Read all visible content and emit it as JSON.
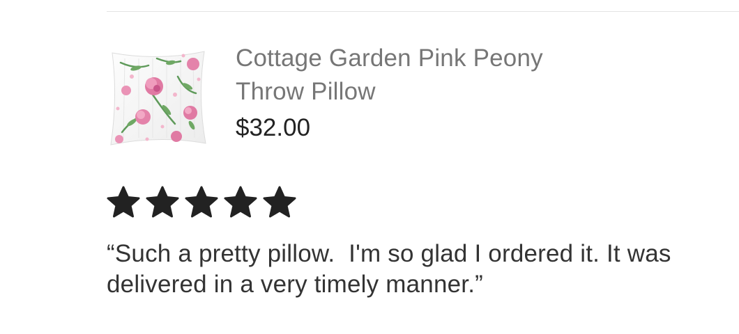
{
  "product": {
    "title_line1": "Cottage Garden Pink Peony",
    "title_line2": "Throw Pillow",
    "price": "$32.00",
    "image_icon": "floral-pillow-thumbnail"
  },
  "review": {
    "rating": 5,
    "rating_max": 5,
    "star_icon": "star-icon",
    "star_color": "#222222",
    "text": "“Such a pretty pillow.  I'm so glad I ordered it. It was delivered in a very timely manner.”"
  },
  "colors": {
    "title": "#767676",
    "price": "#222222",
    "review_text": "#333333",
    "divider": "#e3e3e3"
  }
}
